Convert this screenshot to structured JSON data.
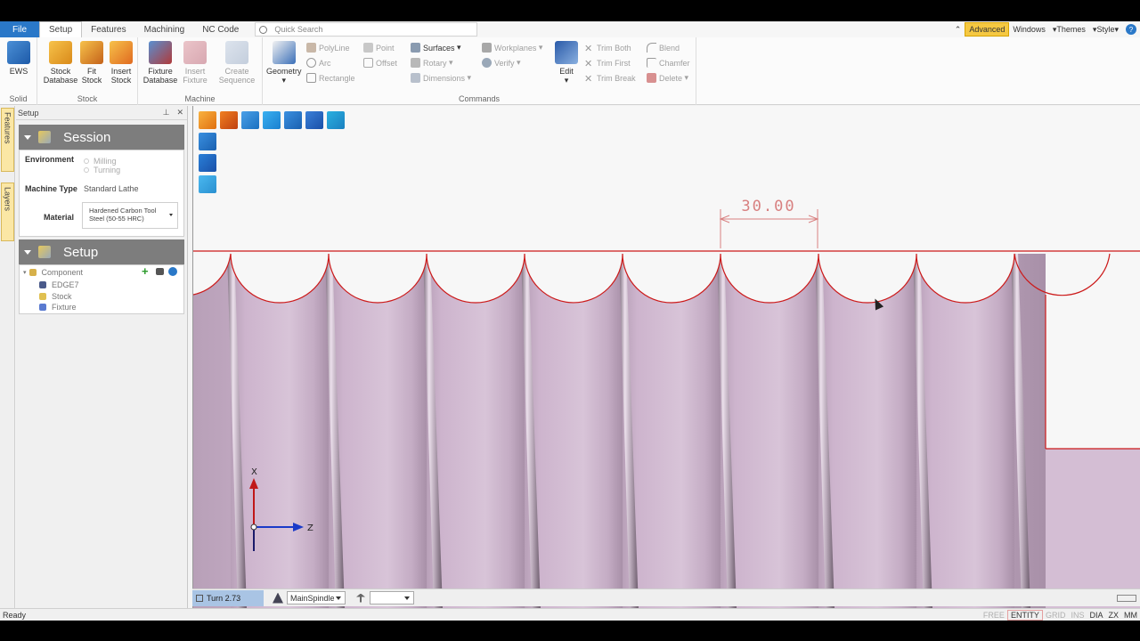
{
  "menu": {
    "file": "File",
    "tabs": [
      "Setup",
      "Features",
      "Machining",
      "NC Code"
    ],
    "active_tab": "Setup",
    "search_placeholder": "Quick Search",
    "right": {
      "advanced": "Advanced",
      "windows": "Windows",
      "themes": "Themes",
      "style": "Style"
    }
  },
  "ribbon": {
    "solid": {
      "label": "Solid",
      "ews": "EWS"
    },
    "stock": {
      "label": "Stock",
      "stock_database": "Stock Database",
      "fit_stock": "Fit Stock",
      "insert_stock": "Insert Stock"
    },
    "machine": {
      "label": "Machine",
      "fixture_database": "Fixture Database",
      "insert_fixture": "Insert Fixture",
      "create_sequence": "Create Sequence"
    },
    "commands": {
      "label": "Commands",
      "geometry": "Geometry",
      "polyline": "PolyLine",
      "arc": "Arc",
      "rectangle": "Rectangle",
      "point": "Point",
      "offset": "Offset",
      "surfaces": "Surfaces",
      "rotary": "Rotary",
      "dimensions": "Dimensions",
      "workplanes": "Workplanes",
      "verify": "Verify",
      "edit": "Edit",
      "trim_both": "Trim Both",
      "trim_first": "Trim First",
      "trim_break": "Trim Break",
      "blend": "Blend",
      "chamfer": "Chamfer",
      "delete": "Delete"
    }
  },
  "side_tabs": [
    "Features",
    "Layers"
  ],
  "panel": {
    "title": "Setup",
    "session": {
      "heading": "Session",
      "environment_label": "Environment",
      "environment_options": [
        "Milling",
        "Turning"
      ],
      "machine_type_label": "Machine Type",
      "machine_type_value": "Standard Lathe",
      "material_label": "Material",
      "material_value": "Hardened Carbon Tool Steel (50-55 HRC)"
    },
    "setup": {
      "heading": "Setup",
      "component": "Component",
      "items": [
        "EDGE7",
        "Stock",
        "Fixture"
      ]
    }
  },
  "viewport": {
    "dimension": "30.00",
    "axis_x": "X",
    "axis_z": "Z"
  },
  "bottombar": {
    "turn": "Turn 2.73",
    "spindle": "MainSpindle"
  },
  "status": {
    "left": "Ready",
    "right": [
      "FREE",
      "ENTITY",
      "GRID",
      "INS",
      "DIA",
      "ZX",
      "MM"
    ]
  },
  "colors": {
    "part": "#cdb6cd",
    "profile": "#cc1a1a",
    "dimension": "#d88080",
    "accent": "#2a78c8"
  }
}
